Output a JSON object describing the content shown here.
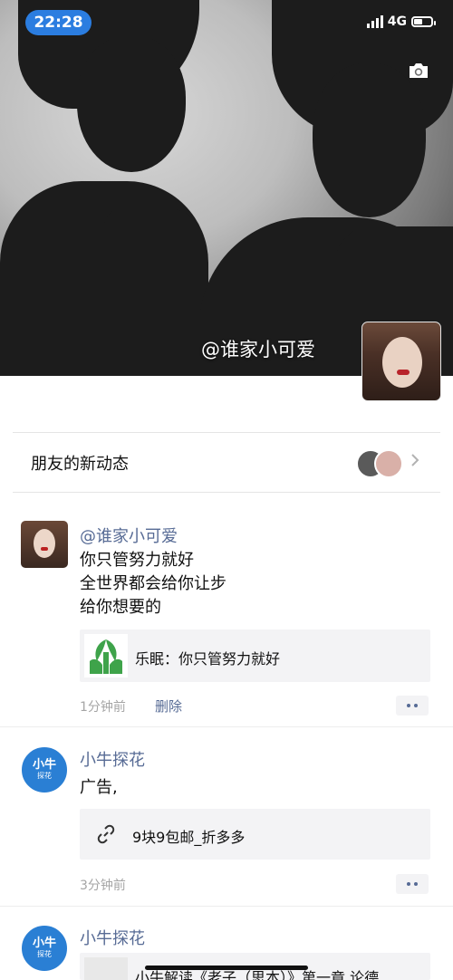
{
  "status": {
    "time": "22:28",
    "network": "4G"
  },
  "cover": {
    "user_name": "@谁家小可爱"
  },
  "friends": {
    "label": "朋友的新动态"
  },
  "posts": [
    {
      "name": "@谁家小可爱",
      "lines": [
        "你只管努力就好",
        "全世界都会给你让步",
        "给你想要的"
      ],
      "link_text": "乐眠：你只管努力就好",
      "time": "1分钟前",
      "delete": "删除"
    },
    {
      "name": "小牛探花",
      "text": "广告,",
      "link_text": "9块9包邮_折多多",
      "time": "3分钟前"
    },
    {
      "name": "小牛探花",
      "link_text": "小牛解读《老子（思本）》第一章 论德"
    }
  ],
  "avatar_text": {
    "line1": "小牛",
    "line2": "探花"
  },
  "colors": {
    "link_blue": "#576b95",
    "time_badge": "#2b7de0",
    "niu_blue": "#2a7fd4"
  }
}
